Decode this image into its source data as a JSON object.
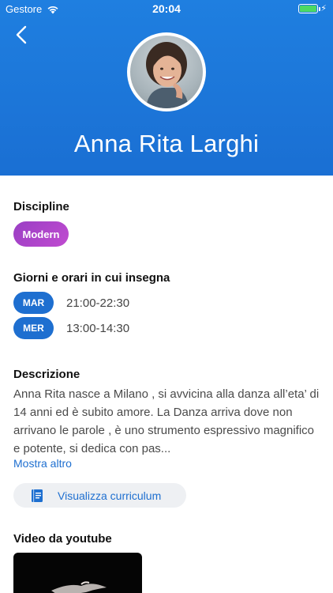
{
  "status_bar": {
    "carrier": "Gestore",
    "time": "20:04",
    "battery_color": "#4cd964"
  },
  "header": {
    "background_color": "#1a6fd3",
    "back_icon": "chevron-left-icon",
    "name": "Anna Rita  Larghi"
  },
  "disciplines": {
    "title": "Discipline",
    "items": [
      "Modern"
    ]
  },
  "schedule": {
    "title": "Giorni e orari in cui insegna",
    "rows": [
      {
        "day": "MAR",
        "time": "21:00-22:30"
      },
      {
        "day": "MER",
        "time": "13:00-14:30"
      }
    ]
  },
  "description": {
    "title": "Descrizione",
    "text": "Anna Rita nasce a Milano , si avvicina alla danza all’eta’ di 14 anni ed è subito amore. La Danza arriva dove non arrivano le parole , è uno strumento espressivo magnifico e potente, si dedica con pas...",
    "more_label": "Mostra altro",
    "cv_button_label": "Visualizza curriculum",
    "cv_icon": "book-icon"
  },
  "video": {
    "title": "Video da youtube"
  },
  "accent_color": "#1e6fd0"
}
